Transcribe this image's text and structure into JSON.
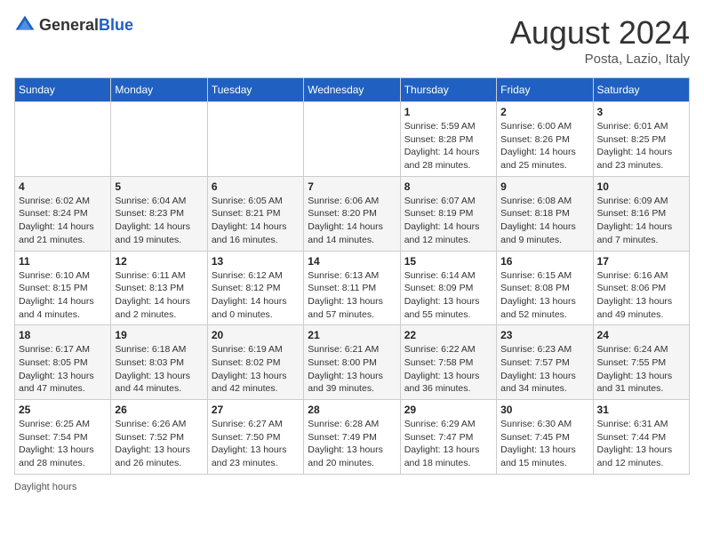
{
  "header": {
    "logo_general": "General",
    "logo_blue": "Blue",
    "month_year": "August 2024",
    "location": "Posta, Lazio, Italy"
  },
  "days_of_week": [
    "Sunday",
    "Monday",
    "Tuesday",
    "Wednesday",
    "Thursday",
    "Friday",
    "Saturday"
  ],
  "weeks": [
    [
      {
        "day": "",
        "info": ""
      },
      {
        "day": "",
        "info": ""
      },
      {
        "day": "",
        "info": ""
      },
      {
        "day": "",
        "info": ""
      },
      {
        "day": "1",
        "info": "Sunrise: 5:59 AM\nSunset: 8:28 PM\nDaylight: 14 hours\nand 28 minutes."
      },
      {
        "day": "2",
        "info": "Sunrise: 6:00 AM\nSunset: 8:26 PM\nDaylight: 14 hours\nand 25 minutes."
      },
      {
        "day": "3",
        "info": "Sunrise: 6:01 AM\nSunset: 8:25 PM\nDaylight: 14 hours\nand 23 minutes."
      }
    ],
    [
      {
        "day": "4",
        "info": "Sunrise: 6:02 AM\nSunset: 8:24 PM\nDaylight: 14 hours\nand 21 minutes."
      },
      {
        "day": "5",
        "info": "Sunrise: 6:04 AM\nSunset: 8:23 PM\nDaylight: 14 hours\nand 19 minutes."
      },
      {
        "day": "6",
        "info": "Sunrise: 6:05 AM\nSunset: 8:21 PM\nDaylight: 14 hours\nand 16 minutes."
      },
      {
        "day": "7",
        "info": "Sunrise: 6:06 AM\nSunset: 8:20 PM\nDaylight: 14 hours\nand 14 minutes."
      },
      {
        "day": "8",
        "info": "Sunrise: 6:07 AM\nSunset: 8:19 PM\nDaylight: 14 hours\nand 12 minutes."
      },
      {
        "day": "9",
        "info": "Sunrise: 6:08 AM\nSunset: 8:18 PM\nDaylight: 14 hours\nand 9 minutes."
      },
      {
        "day": "10",
        "info": "Sunrise: 6:09 AM\nSunset: 8:16 PM\nDaylight: 14 hours\nand 7 minutes."
      }
    ],
    [
      {
        "day": "11",
        "info": "Sunrise: 6:10 AM\nSunset: 8:15 PM\nDaylight: 14 hours\nand 4 minutes."
      },
      {
        "day": "12",
        "info": "Sunrise: 6:11 AM\nSunset: 8:13 PM\nDaylight: 14 hours\nand 2 minutes."
      },
      {
        "day": "13",
        "info": "Sunrise: 6:12 AM\nSunset: 8:12 PM\nDaylight: 14 hours\nand 0 minutes."
      },
      {
        "day": "14",
        "info": "Sunrise: 6:13 AM\nSunset: 8:11 PM\nDaylight: 13 hours\nand 57 minutes."
      },
      {
        "day": "15",
        "info": "Sunrise: 6:14 AM\nSunset: 8:09 PM\nDaylight: 13 hours\nand 55 minutes."
      },
      {
        "day": "16",
        "info": "Sunrise: 6:15 AM\nSunset: 8:08 PM\nDaylight: 13 hours\nand 52 minutes."
      },
      {
        "day": "17",
        "info": "Sunrise: 6:16 AM\nSunset: 8:06 PM\nDaylight: 13 hours\nand 49 minutes."
      }
    ],
    [
      {
        "day": "18",
        "info": "Sunrise: 6:17 AM\nSunset: 8:05 PM\nDaylight: 13 hours\nand 47 minutes."
      },
      {
        "day": "19",
        "info": "Sunrise: 6:18 AM\nSunset: 8:03 PM\nDaylight: 13 hours\nand 44 minutes."
      },
      {
        "day": "20",
        "info": "Sunrise: 6:19 AM\nSunset: 8:02 PM\nDaylight: 13 hours\nand 42 minutes."
      },
      {
        "day": "21",
        "info": "Sunrise: 6:21 AM\nSunset: 8:00 PM\nDaylight: 13 hours\nand 39 minutes."
      },
      {
        "day": "22",
        "info": "Sunrise: 6:22 AM\nSunset: 7:58 PM\nDaylight: 13 hours\nand 36 minutes."
      },
      {
        "day": "23",
        "info": "Sunrise: 6:23 AM\nSunset: 7:57 PM\nDaylight: 13 hours\nand 34 minutes."
      },
      {
        "day": "24",
        "info": "Sunrise: 6:24 AM\nSunset: 7:55 PM\nDaylight: 13 hours\nand 31 minutes."
      }
    ],
    [
      {
        "day": "25",
        "info": "Sunrise: 6:25 AM\nSunset: 7:54 PM\nDaylight: 13 hours\nand 28 minutes."
      },
      {
        "day": "26",
        "info": "Sunrise: 6:26 AM\nSunset: 7:52 PM\nDaylight: 13 hours\nand 26 minutes."
      },
      {
        "day": "27",
        "info": "Sunrise: 6:27 AM\nSunset: 7:50 PM\nDaylight: 13 hours\nand 23 minutes."
      },
      {
        "day": "28",
        "info": "Sunrise: 6:28 AM\nSunset: 7:49 PM\nDaylight: 13 hours\nand 20 minutes."
      },
      {
        "day": "29",
        "info": "Sunrise: 6:29 AM\nSunset: 7:47 PM\nDaylight: 13 hours\nand 18 minutes."
      },
      {
        "day": "30",
        "info": "Sunrise: 6:30 AM\nSunset: 7:45 PM\nDaylight: 13 hours\nand 15 minutes."
      },
      {
        "day": "31",
        "info": "Sunrise: 6:31 AM\nSunset: 7:44 PM\nDaylight: 13 hours\nand 12 minutes."
      }
    ]
  ],
  "footer": {
    "daylight_hours": "Daylight hours"
  }
}
